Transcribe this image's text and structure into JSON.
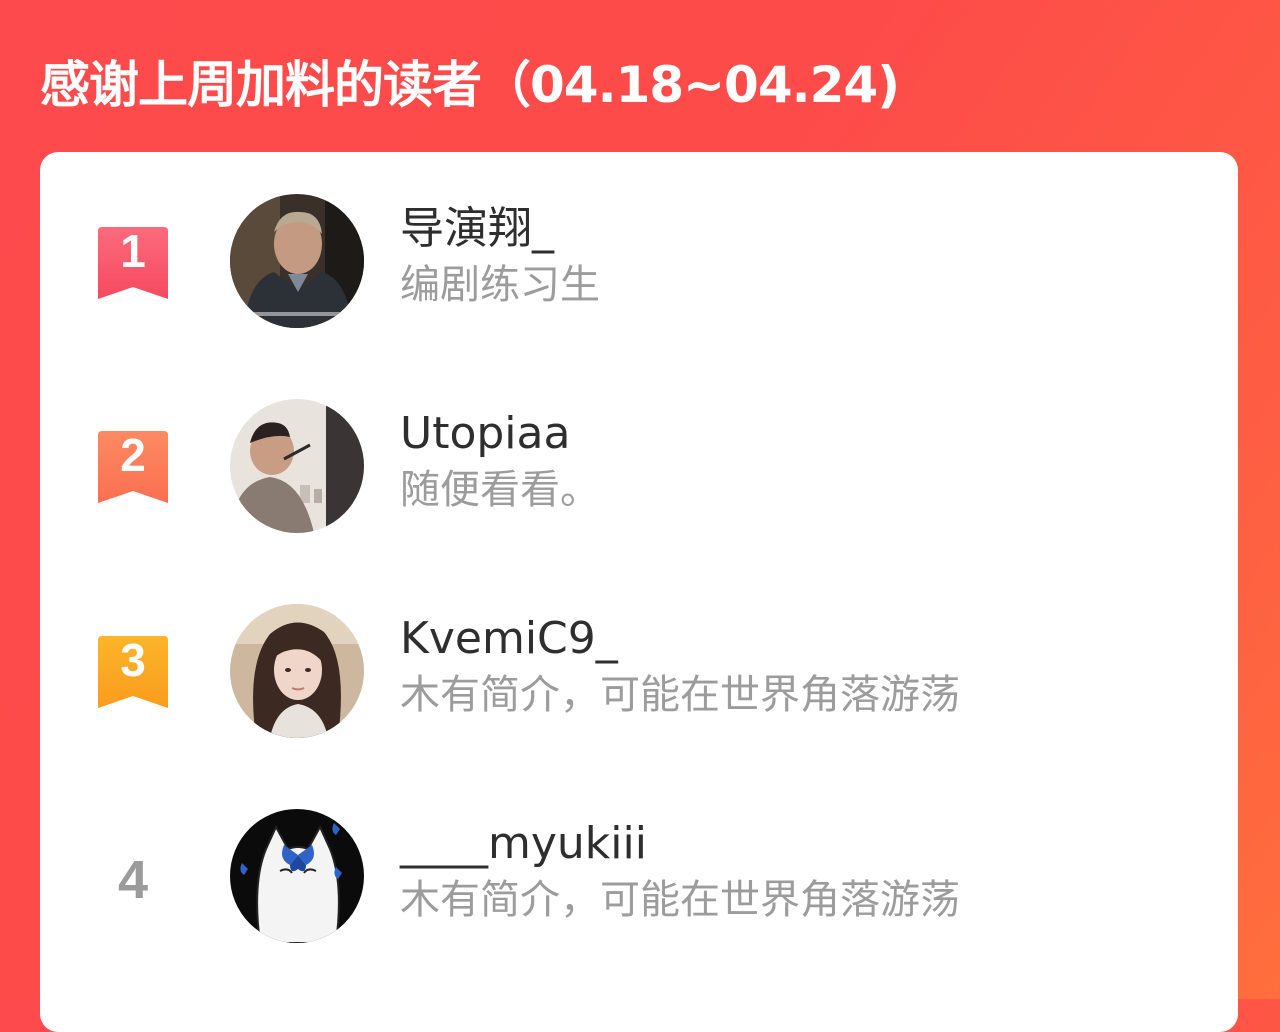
{
  "header": {
    "title": "感谢上周加料的读者（04.18~04.24)"
  },
  "colors": {
    "background_start": "#fd4a4c",
    "background_end": "#ff6e3c",
    "rank1": "#f8566a",
    "rank2": "#fb7a58",
    "rank3": "#fbaa22",
    "username": "#2e2e2e",
    "bio": "#9c9c9c"
  },
  "readers": [
    {
      "rank": "1",
      "username": "导演翔_",
      "bio": "编剧练习生",
      "avatar_icon": "man-in-suit-avatar"
    },
    {
      "rank": "2",
      "username": "Utopiaa",
      "bio": "随便看看。",
      "avatar_icon": "man-with-pen-avatar"
    },
    {
      "rank": "3",
      "username": "KvemiC9_",
      "bio": "木有简介，可能在世界角落游荡",
      "avatar_icon": "woman-portrait-avatar"
    },
    {
      "rank": "4",
      "username": "____myukiii",
      "bio": "木有简介，可能在世界角落游荡",
      "avatar_icon": "white-cat-butterfly-avatar"
    }
  ]
}
